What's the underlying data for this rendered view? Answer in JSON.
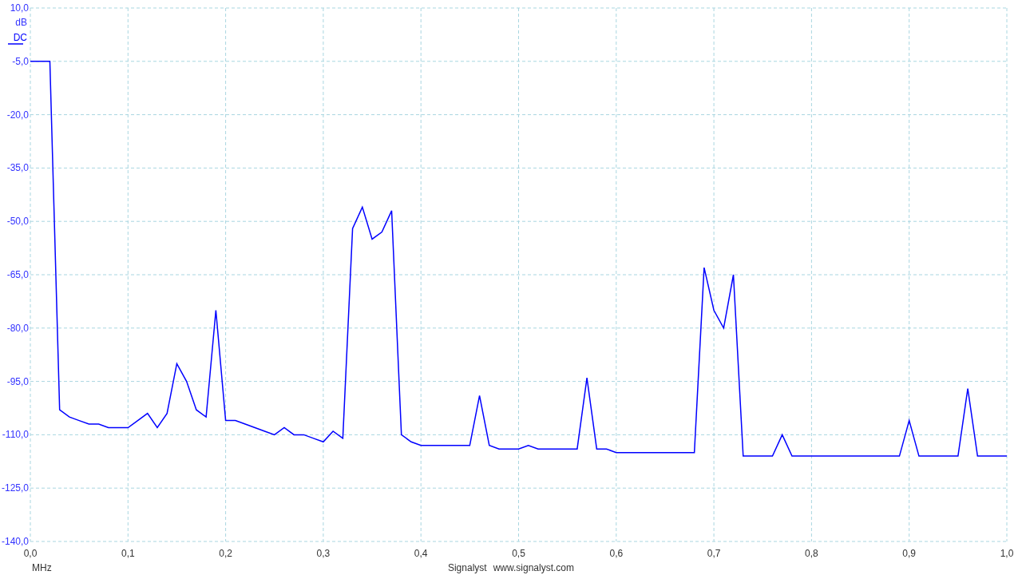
{
  "spectrum": {
    "chart_data": {
      "type": "line",
      "grid": true,
      "ylabel": "dB",
      "xlabel": "MHz",
      "xlim": [
        0,
        1
      ],
      "ylim": [
        -140,
        10
      ],
      "yticks": [
        {
          "value": 10,
          "label": "10,0"
        },
        {
          "value": -5,
          "label": "-5,0"
        },
        {
          "value": -20,
          "label": "-20,0"
        },
        {
          "value": -35,
          "label": "-35,0"
        },
        {
          "value": -50,
          "label": "-50,0"
        },
        {
          "value": -65,
          "label": "-65,0"
        },
        {
          "value": -80,
          "label": "-80,0"
        },
        {
          "value": -95,
          "label": "-95,0"
        },
        {
          "value": -110,
          "label": "-110,0"
        },
        {
          "value": -125,
          "label": "-125,0"
        },
        {
          "value": -140,
          "label": "-140,0"
        }
      ],
      "xticks": [
        {
          "value": 0,
          "label": "0,0"
        },
        {
          "value": 0.1,
          "label": "0,1"
        },
        {
          "value": 0.2,
          "label": "0,2"
        },
        {
          "value": 0.3,
          "label": "0,3"
        },
        {
          "value": 0.4,
          "label": "0,4"
        },
        {
          "value": 0.5,
          "label": "0,5"
        },
        {
          "value": 0.6,
          "label": "0,6"
        },
        {
          "value": 0.7,
          "label": "0,7"
        },
        {
          "value": 0.8,
          "label": "0,8"
        },
        {
          "value": 0.9,
          "label": "0,9"
        },
        {
          "value": 1,
          "label": "1,0"
        }
      ],
      "x": [
        0,
        0.01,
        0.02,
        0.03,
        0.04,
        0.05,
        0.06,
        0.07,
        0.08,
        0.09,
        0.1,
        0.11,
        0.12,
        0.13,
        0.14,
        0.15,
        0.16,
        0.17,
        0.18,
        0.19,
        0.2,
        0.21,
        0.22,
        0.23,
        0.24,
        0.25,
        0.26,
        0.27,
        0.28,
        0.29,
        0.3,
        0.31,
        0.32,
        0.33,
        0.34,
        0.35,
        0.36,
        0.37,
        0.38,
        0.39,
        0.4,
        0.41,
        0.42,
        0.43,
        0.44,
        0.45,
        0.46,
        0.47,
        0.48,
        0.49,
        0.5,
        0.51,
        0.52,
        0.53,
        0.54,
        0.55,
        0.56,
        0.57,
        0.58,
        0.59,
        0.6,
        0.61,
        0.62,
        0.63,
        0.64,
        0.65,
        0.66,
        0.67,
        0.68,
        0.69,
        0.7,
        0.71,
        0.72,
        0.73,
        0.74,
        0.75,
        0.76,
        0.77,
        0.78,
        0.79,
        0.8,
        0.81,
        0.82,
        0.83,
        0.84,
        0.85,
        0.86,
        0.87,
        0.88,
        0.89,
        0.9,
        0.91,
        0.92,
        0.93,
        0.94,
        0.95,
        0.96,
        0.97,
        0.98,
        0.99,
        1
      ],
      "series": [
        {
          "name": "DC",
          "color": "#0000ff",
          "values": [
            -5,
            -5,
            -5,
            -103,
            -105,
            -106,
            -107,
            -107,
            -108,
            -108,
            -108,
            -106,
            -104,
            -108,
            -104,
            -90,
            -95,
            -103,
            -105,
            -75,
            -106,
            -106,
            -107,
            -108,
            -109,
            -110,
            -108,
            -110,
            -110,
            -111,
            -112,
            -109,
            -111,
            -52,
            -46,
            -55,
            -53,
            -47,
            -110,
            -112,
            -113,
            -113,
            -113,
            -113,
            -113,
            -113,
            -99,
            -113,
            -114,
            -114,
            -114,
            -113,
            -114,
            -114,
            -114,
            -114,
            -114,
            -94,
            -114,
            -114,
            -115,
            -115,
            -115,
            -115,
            -115,
            -115,
            -115,
            -115,
            -115,
            -63,
            -75,
            -80,
            -65,
            -116,
            -116,
            -116,
            -116,
            -110,
            -116,
            -116,
            -116,
            -116,
            -116,
            -116,
            -116,
            -116,
            -116,
            -116,
            -116,
            -116,
            -106,
            -116,
            -116,
            -116,
            -116,
            -116,
            -97,
            -116,
            -116,
            -116,
            -116
          ]
        }
      ]
    }
  },
  "footer": {
    "app_name": "Signalyst",
    "url": "www.signalyst.com"
  }
}
